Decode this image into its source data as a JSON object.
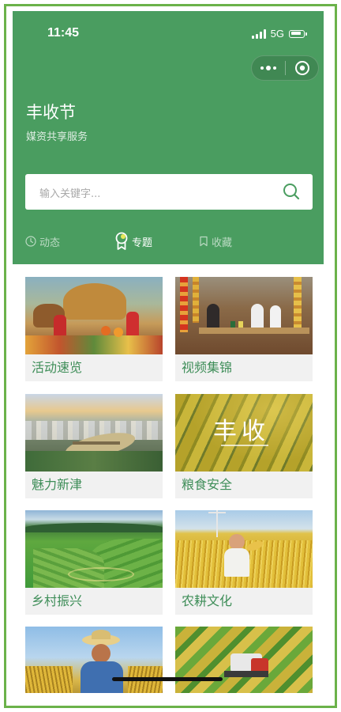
{
  "status_bar": {
    "time": "11:45",
    "network": "5G"
  },
  "header": {
    "title": "丰收节",
    "subtitle": "媒资共享服务",
    "background_color": "#4a9d60"
  },
  "search": {
    "placeholder": "输入关键字..."
  },
  "tabs": [
    {
      "label": "动态",
      "icon": "clock-icon",
      "active": false
    },
    {
      "label": "专题",
      "icon": "badge-icon",
      "active": true
    },
    {
      "label": "收藏",
      "icon": "bookmark-icon",
      "active": false
    }
  ],
  "cards": [
    {
      "label": "活动速览",
      "image": "harvest-festival-display"
    },
    {
      "label": "视频集锦",
      "image": "live-broadcast-scene"
    },
    {
      "label": "魅力新津",
      "image": "city-river-aerial"
    },
    {
      "label": "粮食安全",
      "image": "rice-field-calligraphy"
    },
    {
      "label": "乡村振兴",
      "image": "green-terrace-fields"
    },
    {
      "label": "农耕文化",
      "image": "farmer-wheat-field"
    },
    {
      "label": "",
      "image": "farmer-straw-hat"
    },
    {
      "label": "",
      "image": "combine-harvester-field"
    }
  ],
  "image_overlay_text": "丰收",
  "colors": {
    "accent_green": "#4a9d60",
    "label_green": "#3f8e59",
    "frame_border": "#6bb24a"
  }
}
